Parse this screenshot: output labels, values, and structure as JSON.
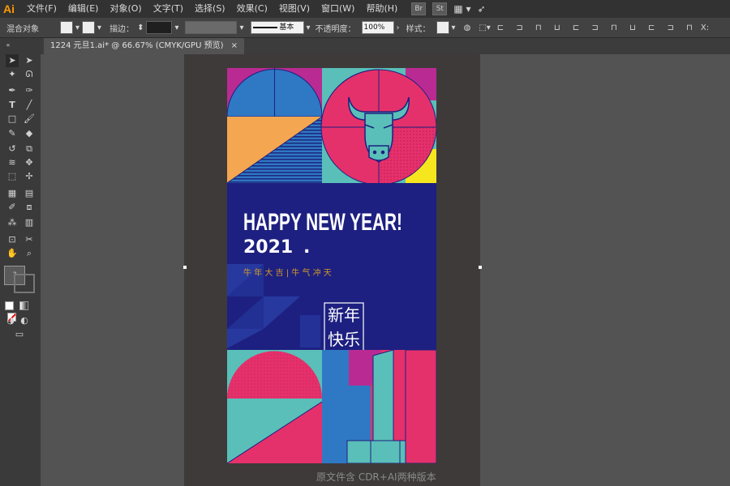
{
  "app": {
    "logo": "Ai"
  },
  "menu": [
    "文件(F)",
    "编辑(E)",
    "对象(O)",
    "文字(T)",
    "选择(S)",
    "效果(C)",
    "视图(V)",
    "窗口(W)",
    "帮助(H)"
  ],
  "menu_icons": [
    "Br",
    "St"
  ],
  "control": {
    "label_mix": "混合对象",
    "label_stroke": "描边：",
    "stroke_profile": "基本",
    "label_opacity": "不透明度：",
    "opacity_value": "100%",
    "label_style": "样式：",
    "coord_label": "X:"
  },
  "document_tab": {
    "title": "1224 元旦1.ai* @ 66.67% (CMYK/GPU 预览)"
  },
  "artwork": {
    "headline": "HAPPY NEW YEAR!",
    "year": "2021",
    "year_dot": ".",
    "phrase": "牛  年  大  吉   |   牛  气  冲  天",
    "stamp_line1": "新年",
    "stamp_line2": "快乐"
  },
  "footer_note": "原文件含 CDR+AI两种版本",
  "colors": {
    "panel_dark": "#323232",
    "panel": "#3a3a3a",
    "canvas": "#535353",
    "artboard_bg": "#3e3a3a",
    "navy": "#1d2080",
    "pink": "#e5316b",
    "teal": "#5abfb8",
    "blue": "#2f78c4",
    "orange": "#f5a650",
    "yellow": "#f6e61d",
    "magenta": "#b92b92"
  },
  "icons": [
    "selection-tool-icon",
    "direct-selection-icon",
    "magic-wand-icon",
    "lasso-icon",
    "pen-icon",
    "curvature-icon",
    "type-icon",
    "line-icon",
    "rectangle-icon",
    "paintbrush-icon",
    "shaper-icon",
    "eraser-icon",
    "rotate-icon",
    "scale-icon",
    "warp-icon",
    "width-icon",
    "free-transform-icon",
    "puppet-warp-icon",
    "mesh-icon",
    "gradient-icon",
    "eyedropper-icon",
    "blend-icon",
    "symbol-sprayer-icon",
    "graph-icon",
    "artboard-icon",
    "slice-icon",
    "hand-icon",
    "zoom-icon"
  ]
}
